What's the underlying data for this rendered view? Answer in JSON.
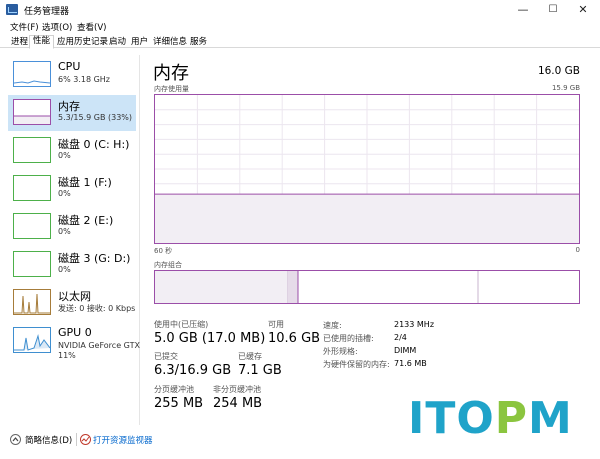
{
  "window": {
    "title": "任务管理器",
    "min_glyph": "—",
    "max_glyph": "☐",
    "close_glyph": "✕"
  },
  "menu": [
    "文件(F)",
    "选项(O)",
    "查看(V)"
  ],
  "tabs": [
    "进程",
    "性能",
    "应用历史记录",
    "启动",
    "用户",
    "详细信息",
    "服务"
  ],
  "active_tab": "性能",
  "sidebar": {
    "items": [
      {
        "title": "CPU",
        "sub": "6% 3.18 GHz",
        "sub2": "",
        "kind": "cpu"
      },
      {
        "title": "内存",
        "sub": "5.3/15.9 GB (33%)",
        "sub2": "",
        "kind": "mem"
      },
      {
        "title": "磁盘 0 (C: H:)",
        "sub": "0%",
        "sub2": "",
        "kind": "disk"
      },
      {
        "title": "磁盘 1 (F:)",
        "sub": "0%",
        "sub2": "",
        "kind": "disk"
      },
      {
        "title": "磁盘 2 (E:)",
        "sub": "0%",
        "sub2": "",
        "kind": "disk"
      },
      {
        "title": "磁盘 3 (G: D:)",
        "sub": "0%",
        "sub2": "",
        "kind": "disk"
      },
      {
        "title": "以太网",
        "sub": "发送: 0 接收: 0 Kbps",
        "sub2": "",
        "kind": "net"
      },
      {
        "title": "GPU 0",
        "sub": "NVIDIA GeForce GTX",
        "sub2": "11%",
        "kind": "gpu"
      }
    ]
  },
  "main": {
    "title": "内存",
    "total": "16.0 GB",
    "usage_label": "内存使用量",
    "usage_max": "15.9 GB",
    "time_left": "60 秒",
    "time_right": "0",
    "composition_label": "内存组合",
    "usage_fraction": 0.33
  },
  "stats": {
    "in_use_label": "使用中(已压缩)",
    "in_use_value": "5.0 GB (17.0 MB)",
    "available_label": "可用",
    "available_value": "10.6 GB",
    "committed_label": "已提交",
    "committed_value": "6.3/16.9 GB",
    "cached_label": "已缓存",
    "cached_value": "7.1 GB",
    "paged_label": "分页缓冲池",
    "paged_value": "255 MB",
    "nonpaged_label": "非分页缓冲池",
    "nonpaged_value": "254 MB"
  },
  "details": [
    {
      "label": "速度:",
      "value": "2133 MHz"
    },
    {
      "label": "已使用的插槽:",
      "value": "2/4"
    },
    {
      "label": "外形规格:",
      "value": "DIMM"
    },
    {
      "label": "为硬件保留的内存:",
      "value": "71.6 MB"
    }
  ],
  "footer": {
    "summary": "简略信息(D)",
    "monitor": "打开资源监视器"
  },
  "watermark": {
    "text": "ITOPM",
    "color_a": "#1fa3c9",
    "color_b": "#8bc53f"
  },
  "colors": {
    "memory": "#9b4ea8",
    "memory_fill": "#f2eef4",
    "selected": "#cce4f7"
  }
}
